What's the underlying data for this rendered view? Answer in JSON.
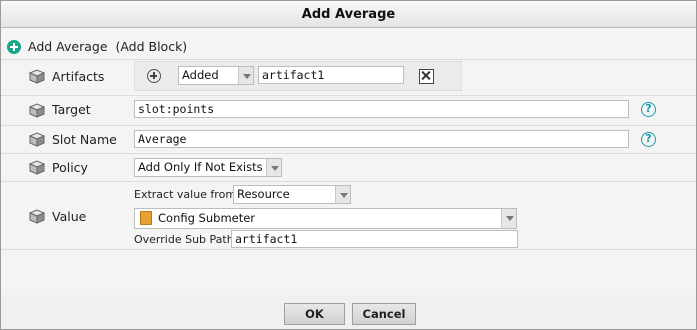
{
  "window": {
    "title": "Add Average"
  },
  "header": {
    "label": "Add Average  (Add Block)"
  },
  "rows": {
    "artifacts": {
      "label": "Artifacts",
      "mode": "Added",
      "value": "artifact1"
    },
    "target": {
      "label": "Target",
      "value": "slot:points"
    },
    "slot_name": {
      "label": "Slot Name",
      "value": "Average"
    },
    "policy": {
      "label": "Policy",
      "value": "Add Only If Not Exists"
    },
    "value": {
      "label": "Value",
      "extract_label": "Extract value from:",
      "extract_value": "Resource",
      "resource_value": "Config Submeter",
      "override_label": "Override Sub Path:",
      "override_value": "artifact1"
    }
  },
  "footer": {
    "ok_label": "OK",
    "cancel_label": "Cancel"
  },
  "icons": {
    "header": "plus-circle-icon",
    "row": "cube-icon",
    "help": "help-icon",
    "add": "add-circle-icon",
    "remove": "remove-x-icon",
    "resource": "folder-icon"
  },
  "colors": {
    "accent": "#1aa58a",
    "help": "#1b9ab0"
  }
}
